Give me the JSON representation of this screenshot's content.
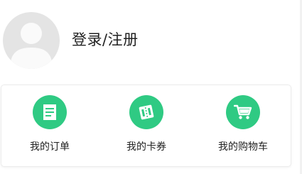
{
  "profile": {
    "login_label": "登录/注册",
    "avatar_icon": "default-user-avatar"
  },
  "quick_actions": [
    {
      "label": "我的订单",
      "icon": "order-document-icon"
    },
    {
      "label": "我的卡券",
      "icon": "coupon-ticket-icon"
    },
    {
      "label": "我的购物车",
      "icon": "shopping-cart-icon"
    }
  ],
  "colors": {
    "accent": "#2fca83",
    "text": "#222222",
    "avatar_bg": "#e4e4e4"
  }
}
